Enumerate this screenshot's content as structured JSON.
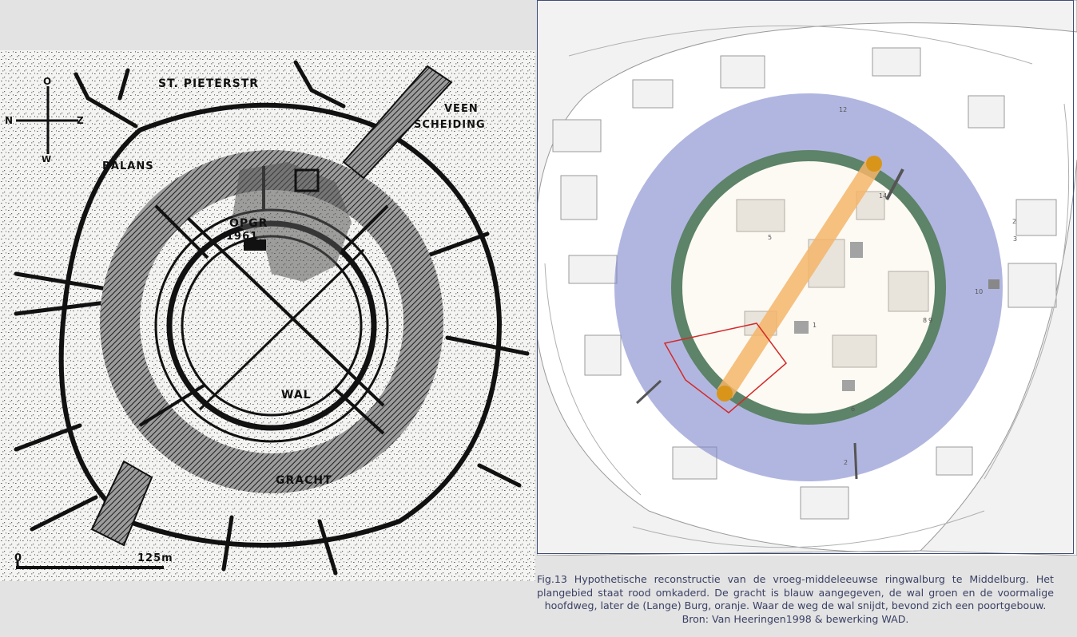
{
  "left_map": {
    "compass": {
      "north": "N",
      "east": "O",
      "south": "Z",
      "west": "W"
    },
    "labels": {
      "street": "ST. PIETERSTR",
      "veen": "VEEN",
      "scheiding": "SCHEIDING",
      "balans": "BALANS",
      "opgr": "OPGR",
      "year": "1961",
      "wal": "WAL",
      "gracht": "GRACHT"
    },
    "scale": {
      "start": "0",
      "end": "125m"
    }
  },
  "right_map": {
    "numbers": [
      "12",
      "14",
      "2",
      "3",
      "1",
      "5",
      "6",
      "8",
      "9",
      "10",
      "2"
    ],
    "colors": {
      "gracht": "#7d86cc",
      "wal": "#4f7a52",
      "burg": "#f5b56a",
      "plangebied": "#d42a2a",
      "poort": "#d9951a"
    }
  },
  "caption": {
    "text": "Fig.13 Hypothetische reconstructie van de vroeg-middeleeuwse ringwalburg te Middelburg. Het plangebied staat rood omkaderd. De gracht is blauw aangegeven, de wal groen en de voormalige hoofdweg, later de (Lange) Burg, oranje. Waar de weg de wal snijdt, bevond zich een poortgebouw.",
    "source": "Bron: Van Heeringen1998 & bewerking WAD."
  }
}
